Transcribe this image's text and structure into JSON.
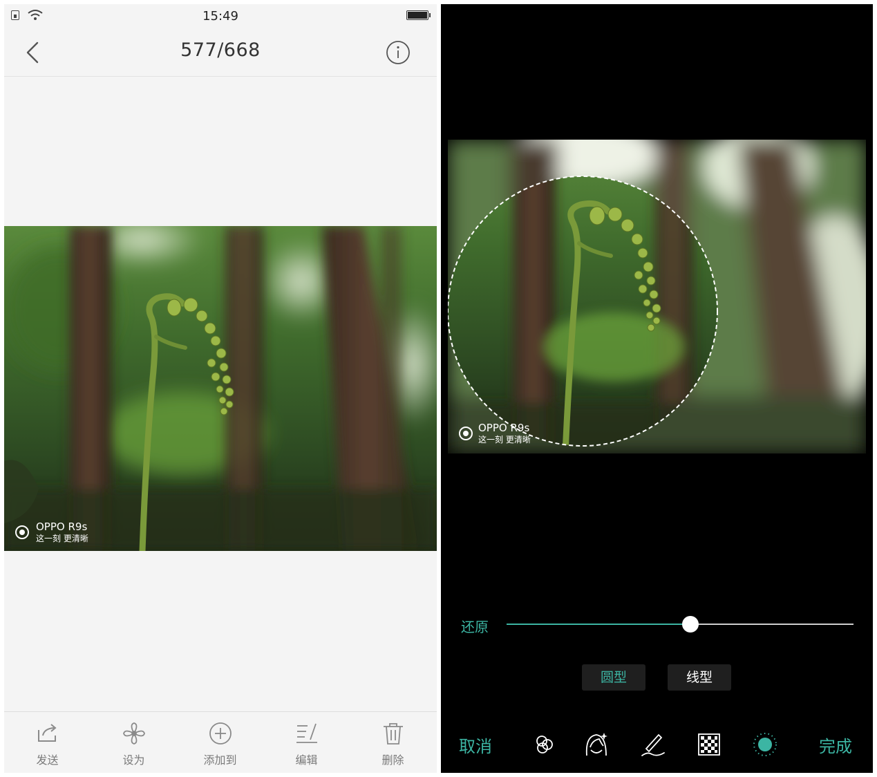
{
  "left": {
    "status_bar": {
      "time": "15:49"
    },
    "header": {
      "counter": "577/668"
    },
    "watermark": {
      "brand": "OPPO R9s",
      "slogan": "这一刻  更清晰"
    },
    "bottom_bar": {
      "send": "发送",
      "set_as": "设为",
      "add_to": "添加到",
      "edit": "编辑",
      "delete": "删除"
    }
  },
  "right": {
    "watermark": {
      "brand": "OPPO R9s",
      "slogan": "这一刻  更清晰"
    },
    "restore_label": "还原",
    "blur_slider": {
      "value": 0.53
    },
    "modes": {
      "round": "圆型",
      "linear": "线型",
      "selected": "圆型"
    },
    "cancel": "取消",
    "done": "完成",
    "tools": [
      "filter-icon",
      "beauty-icon",
      "doodle-icon",
      "mosaic-icon",
      "blur-icon"
    ],
    "active_tool": "blur-icon"
  },
  "colors": {
    "accent": "#3cb5a3",
    "editor_bg": "#000000",
    "viewer_bg": "#f4f4f4"
  }
}
